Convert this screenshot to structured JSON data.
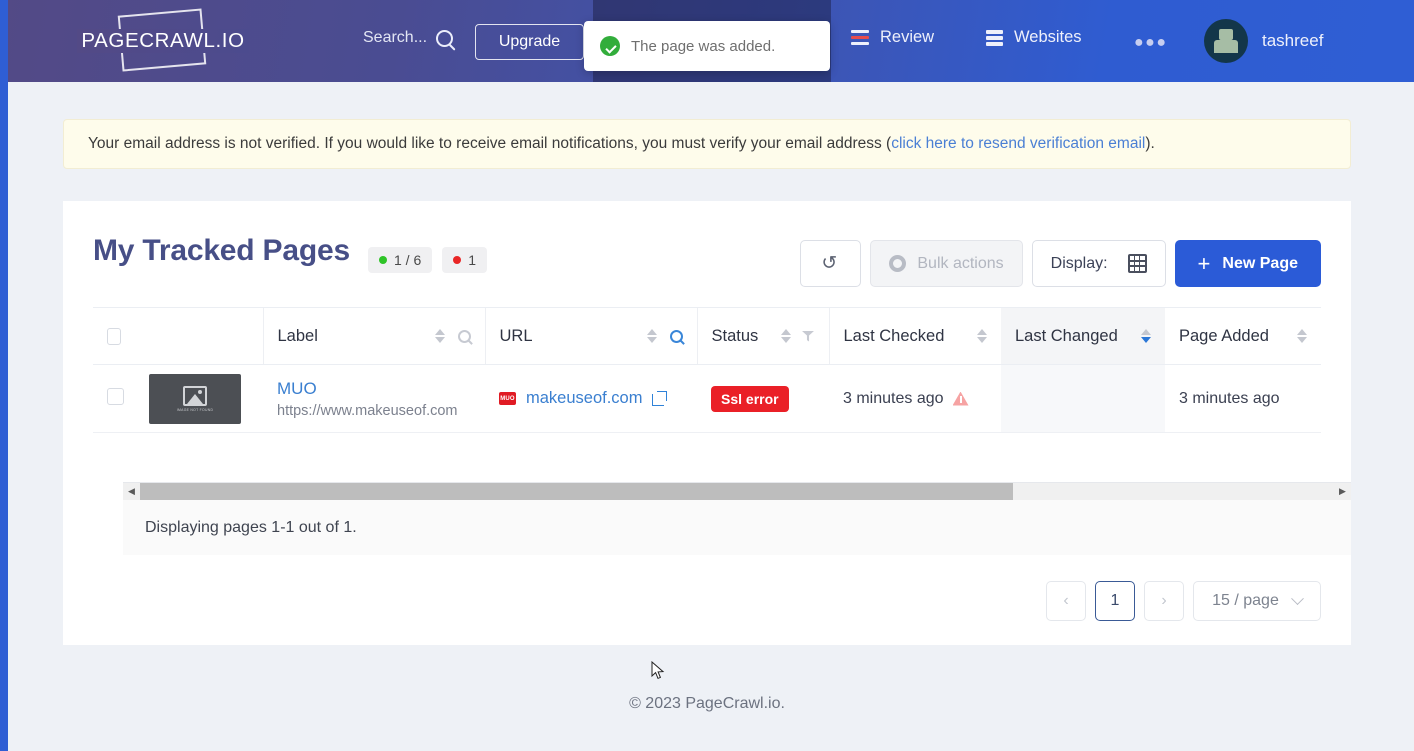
{
  "header": {
    "logo_text": "PAGECRAWL.IO",
    "search_placeholder": "Search...",
    "search_icon": "search-icon",
    "upgrade_label": "Upgrade",
    "toast_message": "The page was added.",
    "toast_icon": "check-circle-icon",
    "nav": [
      {
        "label": "Review",
        "icon": "list-review-icon"
      },
      {
        "label": "Websites",
        "icon": "server-stack-icon"
      }
    ],
    "more_label": "●●●",
    "user_name": "tashreef",
    "avatar_icon": "user-avatar"
  },
  "notice": {
    "text_before": "Your email address is not verified. If you would like to receive email notifications, you must verify your email address (",
    "link_text": "click here to resend verification email",
    "text_after": ")."
  },
  "card": {
    "title": "My Tracked Pages",
    "badges": [
      {
        "dot": "green",
        "text": "1 / 6"
      },
      {
        "dot": "red",
        "text": "1"
      }
    ],
    "toolbar": {
      "refresh_icon": "refresh-icon",
      "bulk_label": "Bulk actions",
      "bulk_icon": "gear-icon",
      "display_label": "Display:",
      "display_icon": "grid-view-icon",
      "new_page_label": "New Page",
      "new_page_icon": "plus-icon"
    },
    "columns": [
      {
        "label": "Label",
        "sortable": true,
        "search": true,
        "sort_state": "none"
      },
      {
        "label": "URL",
        "sortable": true,
        "search": true,
        "search_active": true,
        "sort_state": "none"
      },
      {
        "label": "Status",
        "sortable": true,
        "filter": true,
        "sort_state": "none"
      },
      {
        "label": "Last Checked",
        "sortable": true,
        "sort_state": "none"
      },
      {
        "label": "Last Changed",
        "sortable": true,
        "sort_state": "desc"
      },
      {
        "label": "Page Added",
        "sortable": true,
        "sort_state": "none"
      }
    ],
    "rows": [
      {
        "thumb_caption": "IMAGE NOT FOUND",
        "label": "MUO",
        "label_sub": "https://www.makeuseof.com",
        "favicon_text": "MUO",
        "url": "makeuseof.com",
        "external_icon": "external-link-icon",
        "status": "Ssl error",
        "status_color": "#ea2027",
        "last_checked": "3 minutes ago",
        "last_checked_warning": "warning-triangle-icon",
        "last_changed": "",
        "page_added": "3 minutes ago"
      }
    ],
    "summary": "Displaying pages 1-1 out of 1.",
    "pagination": {
      "prev": "‹",
      "current": "1",
      "next": "›",
      "per_page": "15 / page"
    }
  },
  "footer": {
    "copyright": "© 2023 PageCrawl.io."
  }
}
